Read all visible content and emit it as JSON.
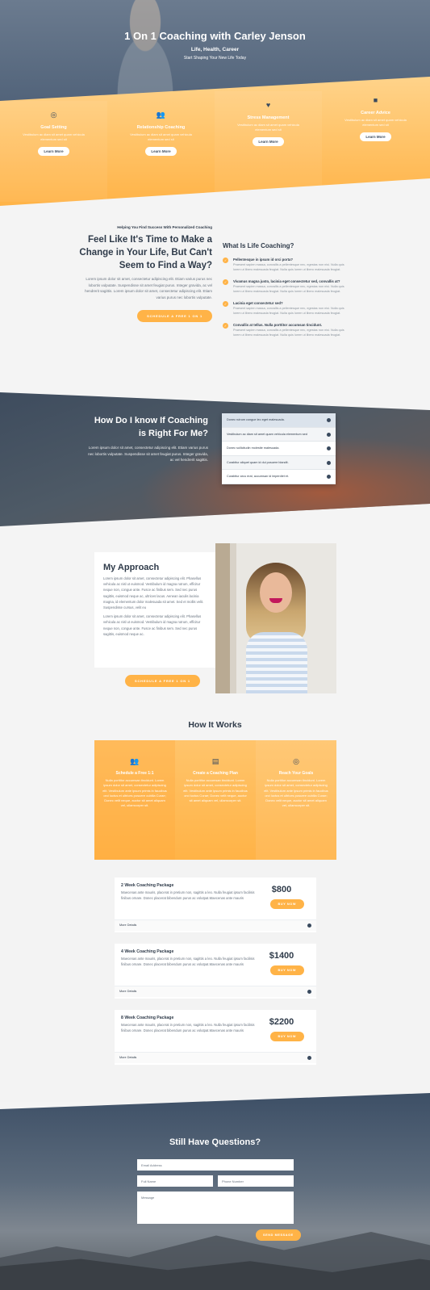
{
  "hero": {
    "title": "1 On 1 Coaching with Carley Jenson",
    "subtitle": "Life, Health, Career",
    "tagline": "Start Shaping Your New Life Today"
  },
  "services": [
    {
      "title": "Goal Setting",
      "desc": "Vestibulum ac diam sit amet quam vehicula elementum sed sit",
      "button": "Learn More",
      "icon": "target-icon"
    },
    {
      "title": "Relationship Coaching",
      "desc": "Vestibulum ac diam sit amet quam vehicula elementum sed sit",
      "button": "Learn More",
      "icon": "people-icon"
    },
    {
      "title": "Stress Management",
      "desc": "Vestibulum ac diam sit amet quam vehicula elementum sed sit",
      "button": "Learn More",
      "icon": "heart-icon"
    },
    {
      "title": "Career Advice",
      "desc": "Vestibulum ac diam sit amet quam vehicula elementum sed sit",
      "button": "Learn More",
      "icon": "briefcase-icon"
    }
  ],
  "intro": {
    "kicker": "Helping You Find Success With Personalized Coaching",
    "heading": "Feel Like It's Time to Make a Change in Your Life, But Can't Seem to Find a Way?",
    "body": "Lorem ipsum dolor sit amet, consectetur adipiscing elit. Etiam varius purus nec lobortis vulputate. Suspendisse sit amet feugiat purus. Integer gravida, ac vel hendrerit sagittis. Lorem ipsum dolor sit amet, consectetur adipiscing elit. Etiam varius purus nec lobortis vulputate.",
    "button": "SCHEDULE A FREE 1 ON 1"
  },
  "what_is": {
    "heading": "What Is Life Coaching?",
    "items": [
      {
        "q": "Pellentesque in ipsum id orci porta?",
        "a": "Praesent sapien massa, convallis a pellentesque nec, egestas non nisi. Nulla quis lorem ut libero malesuada feugiat. Nulla quis lorem ut libero malesuada feugiat."
      },
      {
        "q": "Vivamus magna justo, lacinia eget consectetur sed, convallis at?",
        "a": "Praesent sapien massa, convallis a pellentesque nec, egestas non nisi. Nulla quis lorem ut libero malesuada feugiat. Nulla quis lorem ut libero malesuada feugiat."
      },
      {
        "q": "Lacinia eget consectetur sed?",
        "a": "Praesent sapien massa, convallis a pellentesque nec, egestas non nisi. Nulla quis lorem ut libero malesuada feugiat. Nulla quis lorem ut libero malesuada feugiat."
      },
      {
        "q": "Convallis at tellus. Nulla porttitor accumsan tincidunt.",
        "a": "Praesent sapien massa, convallis a pellentesque nec, egestas non nisi. Nulla quis lorem ut libero malesuada feugiat. Nulla quis lorem ut libero malesuada feugiat."
      }
    ]
  },
  "fit": {
    "heading": "How Do I know If Coaching is Right For Me?",
    "body": "Lorem ipsum dolor sit amet, consectetur adipiscing elit. Etiam varius purus nec lobortis vulputate. Suspendisse sit amet feugiat purus. Integer gravida, ac vel hendrerit sagittis.",
    "accordion": [
      "Donec rutrum congue leo eget malesuada.",
      "Vestibulum ac diam sit amet quam vehicula elementum sed",
      "Donec sollicitudin molestie malesuada.",
      "Curabitur aliquet quam id dui posuere blandit.",
      "Curabitur arcu erat, accumsan id imperdiet et."
    ]
  },
  "approach": {
    "heading": "My Approach",
    "p1": "Lorem ipsum dolor sit amet, consectetur adipiscing elit. Phasellus vehicula ac nisl ut euismod. Vestibulum id magna rutrum, efficitur neque non, congue ante. Fusce ac finibus sem. Sed nec purus sagittis, euismod neque ac, ultrices lacus. Aenean iaculis lacinia magna, id elementum dolor malesuada sit amet. Sed et mollis velit. Suspendisse cursus, velit eu",
    "p2": "Lorem ipsum dolor sit amet, consectetur adipiscing elit. Phasellus vehicula ac nisl ut euismod. Vestibulum id magna rutrum, efficitur neque non, congue ante. Fusce ac finibus sem. Sed nec purus sagittis, euismod neque ac.",
    "button": "SCHEDULE A FREE 1 ON 1"
  },
  "how": {
    "heading": "How It Works",
    "steps": [
      {
        "title": "Schedule a Free 1:1",
        "desc": "Nulla porttitor accumsan tincidunt. Lorem ipsum dolor sit amet, consectetur adipiscing elit. Vestibulum ante ipsum primis in faucibus orci luctus et ultrices posuere cubilia Curae; Donec velit neque, auctor sit amet aliquam vel, ullamcorper sit.",
        "icon": "people-icon"
      },
      {
        "title": "Create a Coaching Plan",
        "desc": "Nulla porttitor accumsan tincidunt. Lorem ipsum dolor sit amet, consectetur adipiscing elit. Vestibulum ante ipsum primis in faucibus orci luctus Curae; Donec velit neque, auctor sit amet aliquam vel, ullamcorper sit.",
        "icon": "document-icon"
      },
      {
        "title": "Reach Your Goals",
        "desc": "Nulla porttitor accumsan tincidunt. Lorem ipsum dolor sit amet, consectetur adipiscing elit. Vestibulum ante ipsum primis in faucibus orci luctus et ultrices posuere cubilia Curae; Donec velit neque, auctor sit amet aliquam vel, ullamcorper sit.",
        "icon": "target-icon"
      }
    ]
  },
  "packages": [
    {
      "name": "2 Week Coaching Package",
      "desc": "Maecenas ante mauris, placerat in pretium non, sagittis a leo. Nulla feugiat ipsum facilisis finibus ornare. Donec placerat bibendum purus ac volutpat.Maecenas ante mauris",
      "price": "$800",
      "button": "BUY NOW",
      "more": "More Details"
    },
    {
      "name": "4 Week Coaching Package",
      "desc": "Maecenas ante mauris, placerat in pretium non, sagittis a leo. Nulla feugiat ipsum facilisis finibus ornare. Donec placerat bibendum purus ac volutpat.Maecenas ante mauris",
      "price": "$1400",
      "button": "BUY NOW",
      "more": "More Details"
    },
    {
      "name": "8 Week Coaching Package",
      "desc": "Maecenas ante mauris, placerat in pretium non, sagittis a leo. Nulla feugiat ipsum facilisis finibus ornare. Donec placerat bibendum purus ac volutpat.Maecenas ante mauris",
      "price": "$2200",
      "button": "BUY NOW",
      "more": "More Details"
    }
  ],
  "contact": {
    "heading": "Still Have Questions?",
    "email_placeholder": "Email Address",
    "name_placeholder": "Full Name",
    "phone_placeholder": "Phone Number",
    "message_placeholder": "Message",
    "button": "SEND MESSAGE"
  },
  "colors": {
    "accent": "#ffb347",
    "dark": "#2f3b4a"
  }
}
